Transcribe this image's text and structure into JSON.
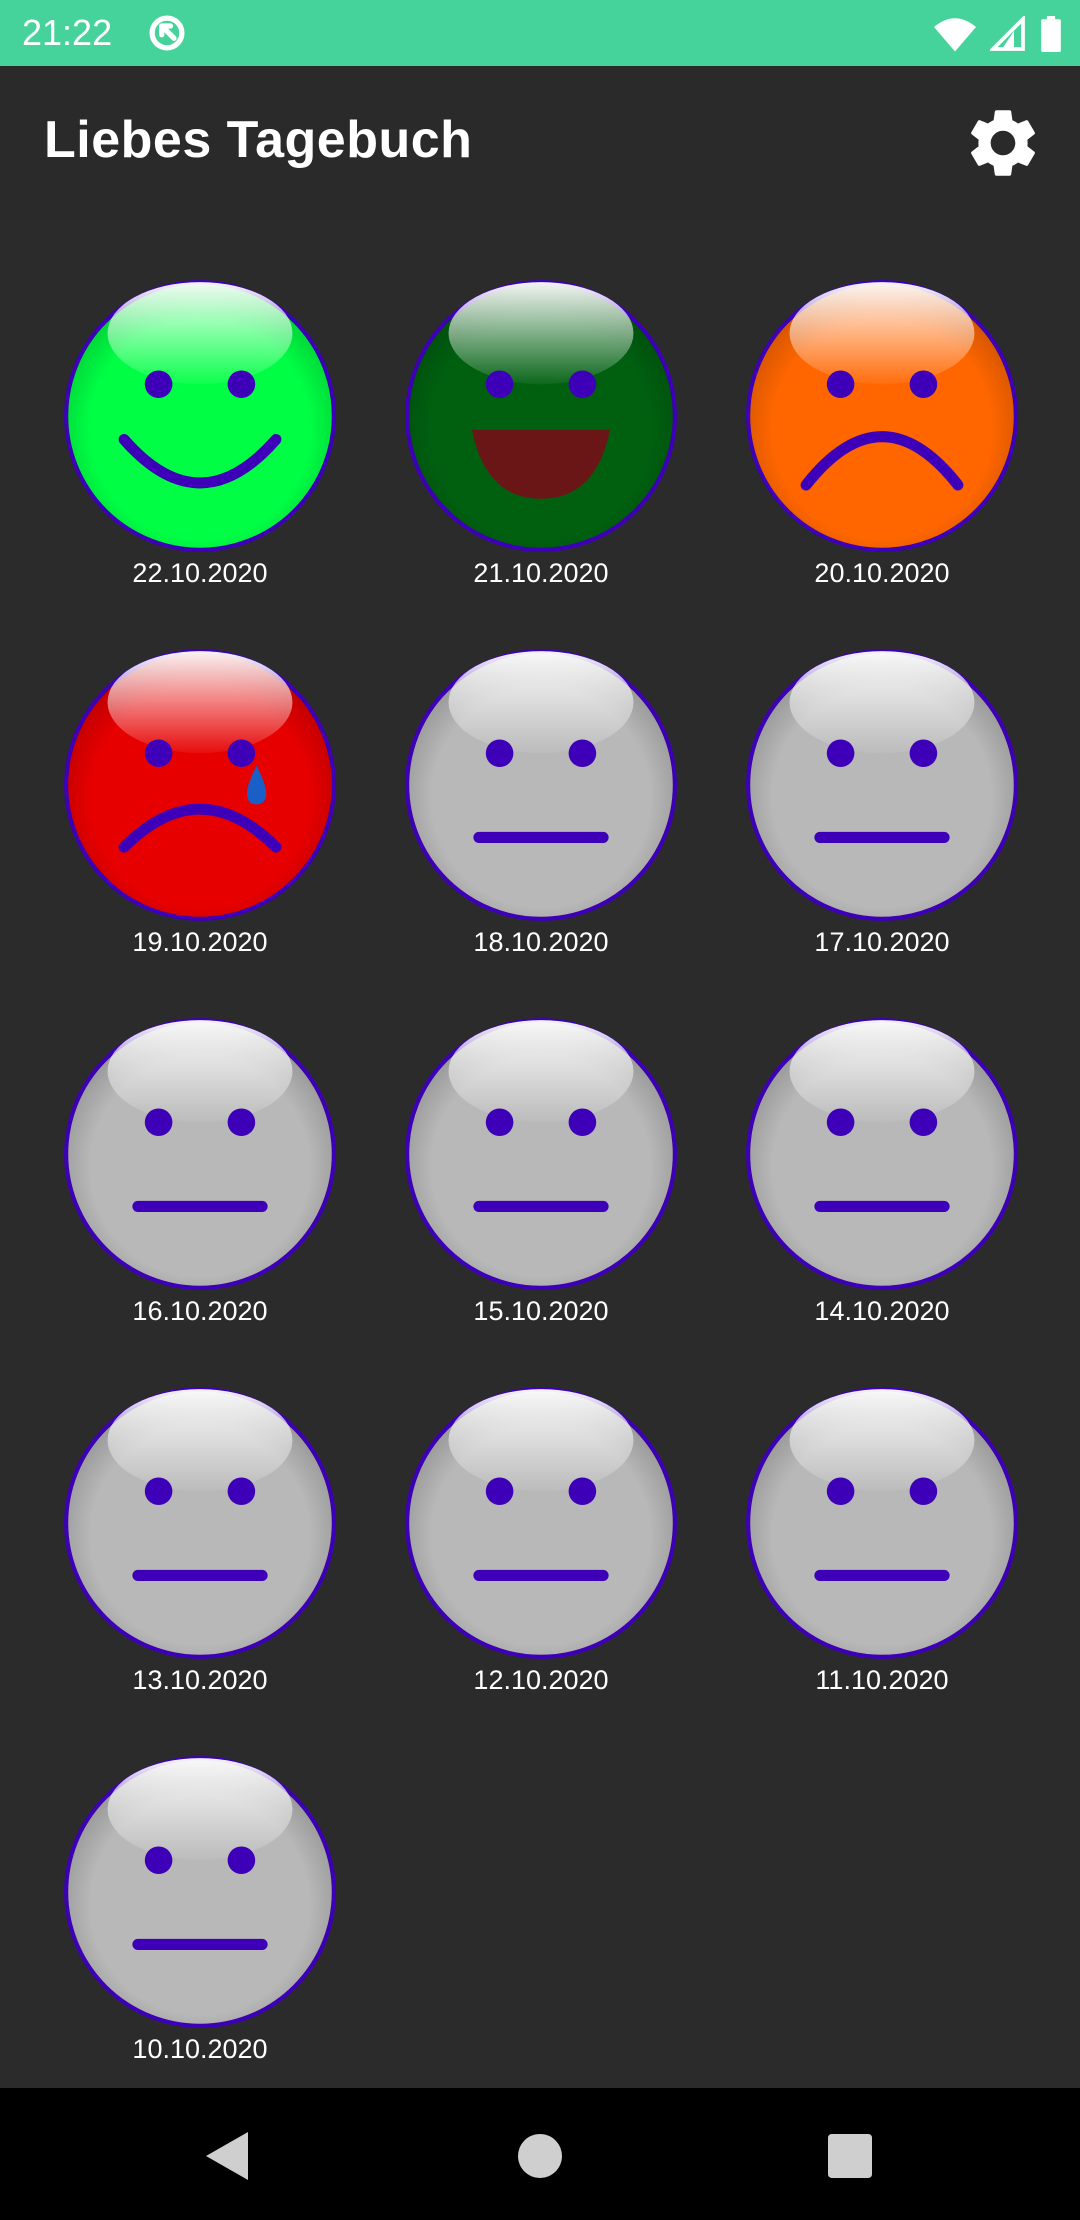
{
  "status_bar": {
    "time": "21:22",
    "background": "#46d39b",
    "icons": [
      "sync-icon",
      "wifi-icon",
      "signal-icon",
      "battery-icon"
    ]
  },
  "app_bar": {
    "title": "Liebes Tagebuch",
    "settings_icon": "gear-icon"
  },
  "entries": [
    {
      "date": "22.10.2020",
      "mood": "happy",
      "color": "#00ff44"
    },
    {
      "date": "21.10.2020",
      "mood": "laughing",
      "color": "#006010"
    },
    {
      "date": "20.10.2020",
      "mood": "sad",
      "color": "#ff6600"
    },
    {
      "date": "19.10.2020",
      "mood": "crying",
      "color": "#e60000"
    },
    {
      "date": "18.10.2020",
      "mood": "neutral",
      "color": "#b8b8b8"
    },
    {
      "date": "17.10.2020",
      "mood": "neutral",
      "color": "#b8b8b8"
    },
    {
      "date": "16.10.2020",
      "mood": "neutral",
      "color": "#b8b8b8"
    },
    {
      "date": "15.10.2020",
      "mood": "neutral",
      "color": "#b8b8b8"
    },
    {
      "date": "14.10.2020",
      "mood": "neutral",
      "color": "#b8b8b8"
    },
    {
      "date": "13.10.2020",
      "mood": "neutral",
      "color": "#b8b8b8"
    },
    {
      "date": "12.10.2020",
      "mood": "neutral",
      "color": "#b8b8b8"
    },
    {
      "date": "11.10.2020",
      "mood": "neutral",
      "color": "#b8b8b8"
    },
    {
      "date": "10.10.2020",
      "mood": "neutral",
      "color": "#b8b8b8"
    }
  ],
  "nav_bar": {
    "back_icon": "back-triangle-icon",
    "home_icon": "home-circle-icon",
    "recents_icon": "recents-square-icon"
  }
}
